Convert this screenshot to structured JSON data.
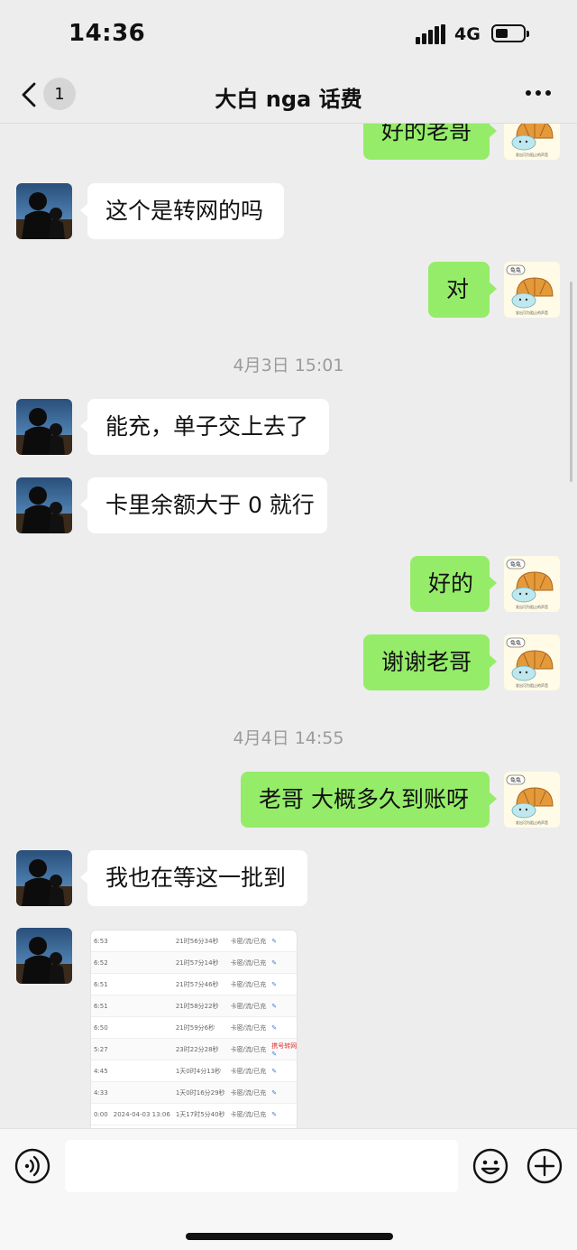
{
  "status": {
    "time": "14:36",
    "network": "4G"
  },
  "nav": {
    "unread": "1",
    "title": "大白 nga 话费"
  },
  "messages": [
    {
      "side": "out",
      "text": "好的老哥"
    },
    {
      "side": "in",
      "text": "这个是转网的吗"
    },
    {
      "side": "out",
      "text": "对"
    },
    {
      "side": "time",
      "text": "4月3日 15:01"
    },
    {
      "side": "in",
      "text": "能充，单子交上去了"
    },
    {
      "side": "in",
      "text": "卡里余额大于 0 就行"
    },
    {
      "side": "out",
      "text": "好的"
    },
    {
      "side": "out",
      "text": "谢谢老哥"
    },
    {
      "side": "time",
      "text": "4月4日 14:55"
    },
    {
      "side": "out",
      "text": "老哥 大概多久到账呀"
    },
    {
      "side": "in",
      "text": "我也在等这一批到"
    }
  ],
  "sticker": {
    "tag": "龟龟",
    "caption": "发出可为阻止的声音"
  },
  "screenshot_rows": [
    {
      "time": "6:53",
      "date": "",
      "duration": "21时56分34秒",
      "status": "卡密/流/已充"
    },
    {
      "time": "6:52",
      "date": "",
      "duration": "21时57分14秒",
      "status": "卡密/流/已充"
    },
    {
      "time": "6:51",
      "date": "",
      "duration": "21时57分46秒",
      "status": "卡密/流/已充"
    },
    {
      "time": "6:51",
      "date": "",
      "duration": "21时58分22秒",
      "status": "卡密/流/已充"
    },
    {
      "time": "6:50",
      "date": "",
      "duration": "21时59分6秒",
      "status": "卡密/流/已充"
    },
    {
      "time": "5:27",
      "date": "",
      "duration": "23时22分28秒",
      "status": "卡密/流/已充",
      "note": "携号转网"
    },
    {
      "time": "4:45",
      "date": "",
      "duration": "1天0时4分13秒",
      "status": "卡密/流/已充"
    },
    {
      "time": "4:33",
      "date": "",
      "duration": "1天0时16分29秒",
      "status": "卡密/流/已充"
    },
    {
      "time": "0:00",
      "date": "2024-04-03 13:06",
      "duration": "1天17时5分40秒",
      "status": "卡密/流/已充"
    }
  ],
  "input": {
    "placeholder": ""
  }
}
